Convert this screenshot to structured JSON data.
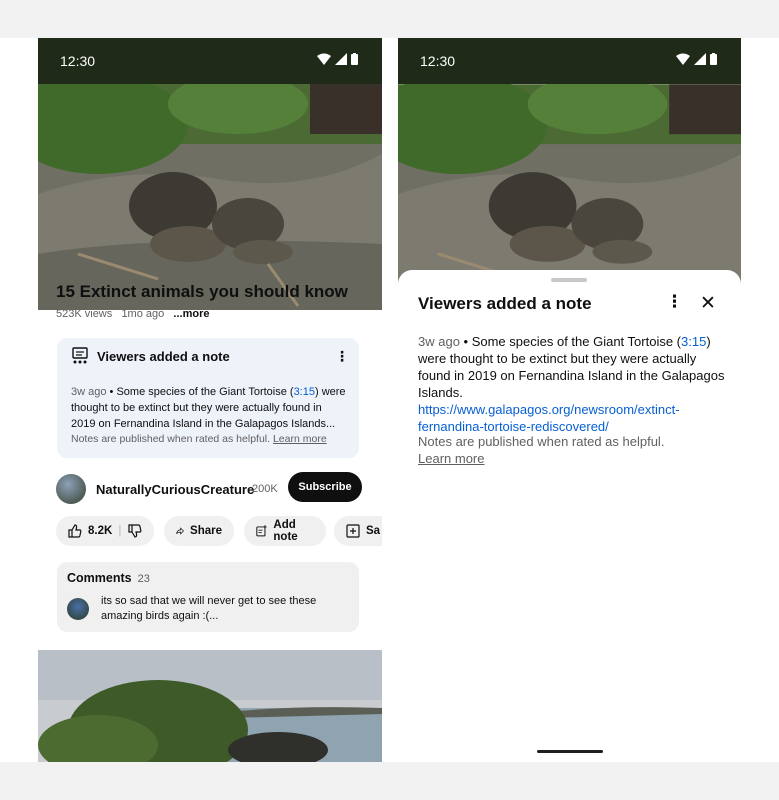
{
  "left_screen": {
    "status": {
      "time": "12:30"
    },
    "video": {
      "title": "15 Extinct animals you should know",
      "views": "523K views",
      "age": "1mo ago",
      "more": "...more"
    },
    "note_card": {
      "header": "Viewers added a note",
      "age": "3w ago",
      "dot": " • ",
      "text_before": "Some species of the Giant Tortoise (",
      "timestamp": "3:15",
      "text_after": ") were thought to be extinct but they were actually found in 2019 on Fernandina Island in the Galapagos Islands...",
      "footer": "Notes are published when rated as helpful.",
      "learn_more": "Learn more"
    },
    "channel": {
      "name": "NaturallyCuriousCreature",
      "subscribers": "200K",
      "subscribe_label": "Subscribe"
    },
    "actions": {
      "likes": "8.2K",
      "share": "Share",
      "add_note": "Add note",
      "save": "Sa"
    },
    "comments": {
      "label": "Comments",
      "count": "23",
      "top_comment": "its so sad that we will never get to see these amazing birds again :(..."
    }
  },
  "right_screen": {
    "status": {
      "time": "12:30"
    },
    "sheet": {
      "title": "Viewers added a note",
      "age": "3w ago",
      "dot": " • ",
      "text_before": "Some species of the Giant Tortoise (",
      "timestamp": "3:15",
      "text_after": ") were thought to be extinct but they were actually found in 2019 on Fernandina Island in the Galapagos Islands. ",
      "url": "https://www.galapagos.org/newsroom/extinct-fernandina-tortoise-rediscovered/",
      "footer": "Notes are published when rated as helpful.",
      "learn_more": "Learn more"
    }
  },
  "colors": {
    "link": "#065fd4",
    "note_bg": "#eef2f9",
    "subscribe_bg": "#0f0f0f"
  }
}
